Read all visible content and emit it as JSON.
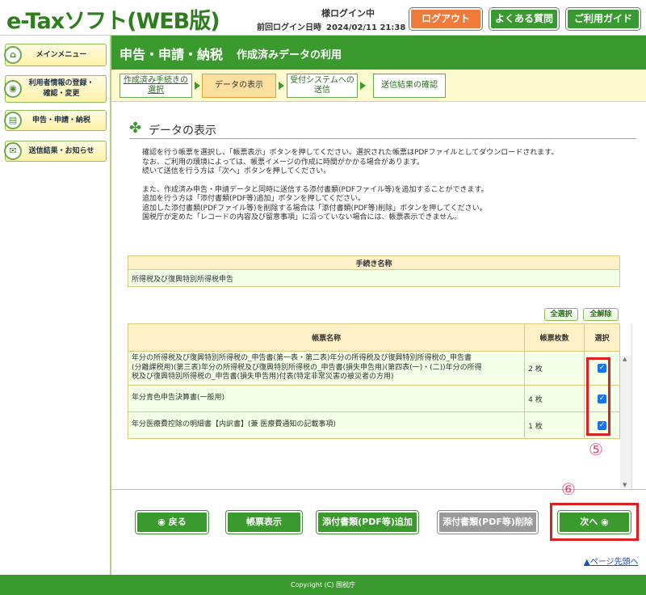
{
  "header": {
    "logo": "e-Taxソフト(WEB版)",
    "login_status": "様ログイン中",
    "last_login_label": "前回ログイン日時",
    "last_login_value": "2024/02/11 21:38",
    "logout": "ログアウト",
    "faq": "よくある質問",
    "guide": "ご利用ガイド"
  },
  "sidebar": {
    "items": [
      {
        "label": "メインメニュー"
      },
      {
        "label_line1": "利用者情報の登録・",
        "label_line2": "確認・変更"
      },
      {
        "label": "申告・申請・納税"
      },
      {
        "label": "送信結果・お知らせ"
      }
    ]
  },
  "title": {
    "main": "申告・申請・納税",
    "sub": "作成済みデータの利用"
  },
  "steps": [
    {
      "line1": "作成済み手続きの",
      "line2": "選択"
    },
    {
      "line1": "データの表示"
    },
    {
      "line1": "受付システムへの",
      "line2": "送信"
    },
    {
      "line1": "送信結果の確認"
    }
  ],
  "section_title": "データの表示",
  "intro": {
    "line1": "確認を行う帳票を選択し、「帳票表示」ボタンを押してください。選択された帳票はPDFファイルとしてダウンロードされます。",
    "line2": "なお、ご利用の環境によっては、帳票イメージの作成に時間がかかる場合があります。",
    "line3": "続いて送信を行う方は「次へ」ボタンを押してください。",
    "line4": "また、作成済み申告・申請データと同時に送信する添付書類(PDFファイル等)を追加することができます。",
    "line5": "追加を行う方は「添付書類(PDF等)追加」ボタンを押してください。",
    "line6": "追加した添付書類(PDFファイル等)を削除する場合は「添付書類(PDF等)削除」ボタンを押してください。",
    "line7": "国税庁が定めた「レコードの内容及び留意事項」に沿っていない場合には、帳票表示できません。"
  },
  "procedure_table": {
    "header": "手続き名称",
    "value": "所得税及び復興特別所得税申告"
  },
  "select_all": "全選択",
  "deselect_all": "全解除",
  "form_table": {
    "headers": {
      "name": "帳票名称",
      "count": "帳票枚数",
      "select": "選択"
    },
    "rows": [
      {
        "name_line1": "年分の所得税及び復興特別所得税の_申告書(第一表・第二表)年分の所得税及び復興特別所得税の_申告書",
        "name_line2": "(分離課税用)(第三表)年分の所得税及び復興特別所得税の_申告書(損失申告用)(第四表(一)・(二))年分の所得",
        "name_line3": "税及び復興特別所得税の_申告書(損失申告用)付表(特定非常災害の被災者の方用)",
        "count": "2 枚",
        "check": "✓"
      },
      {
        "name": "年分青色申告決算書(一般用)",
        "count": "4 枚",
        "check": "✓"
      },
      {
        "name": "年分医療費控除の明細書【内訳書】(兼 医療費通知の記載事項)",
        "count": "1 枚",
        "check": "✓"
      }
    ]
  },
  "markers": {
    "five": "⑤",
    "six": "⑥"
  },
  "buttons": {
    "back": "◉ 戻る",
    "view": "帳票表示",
    "add_attachment": "添付書類(PDF等)追加",
    "delete_attachment": "添付書類(PDF等)削除",
    "next": "次へ ◉"
  },
  "page_top": "▲ページ先頭へ",
  "footer": "Copyright (C) 国税庁",
  "colors": {
    "brand_green": "#3b9a2e",
    "logout_orange": "#f07a3a",
    "highlight_red": "#e02020"
  }
}
